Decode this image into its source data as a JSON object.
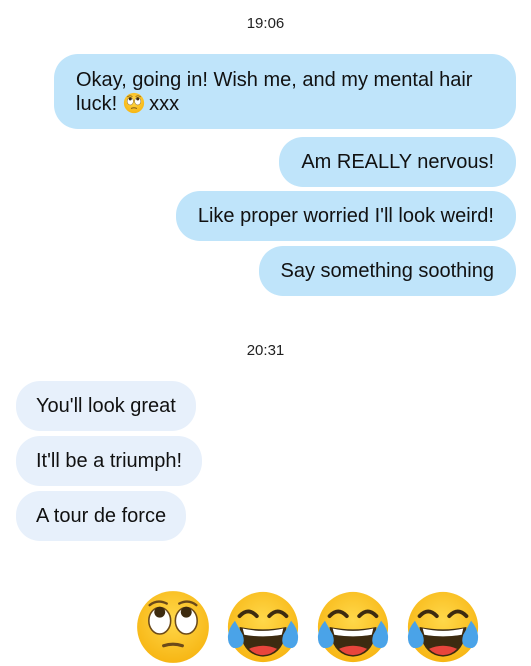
{
  "conversation": {
    "timestamp_1": "19:06",
    "timestamp_2": "20:31",
    "outgoing": [
      {
        "line1": "Okay, going in! Wish me, and my mental hair",
        "line2_start": "luck!",
        "line2_end": "xxx",
        "emoji": "face-with-rolling-eyes-icon"
      },
      {
        "text": "Am REALLY nervous!"
      },
      {
        "text": "Like proper worried I'll look weird!"
      },
      {
        "text": "Say something soothing"
      }
    ],
    "incoming": [
      {
        "text": "You'll look great"
      },
      {
        "text": "It'll be a triumph!"
      },
      {
        "text": "A tour de force"
      }
    ],
    "emoji_reaction": [
      "face-with-rolling-eyes-icon",
      "face-with-tears-of-joy-icon",
      "face-with-tears-of-joy-icon",
      "face-with-tears-of-joy-icon"
    ]
  },
  "colors": {
    "outgoing_bubble": "#bfe4fa",
    "incoming_bubble": "#e7f0fb",
    "emoji_yellow": "#fcc21b",
    "tear_blue": "#4aa3e8"
  }
}
